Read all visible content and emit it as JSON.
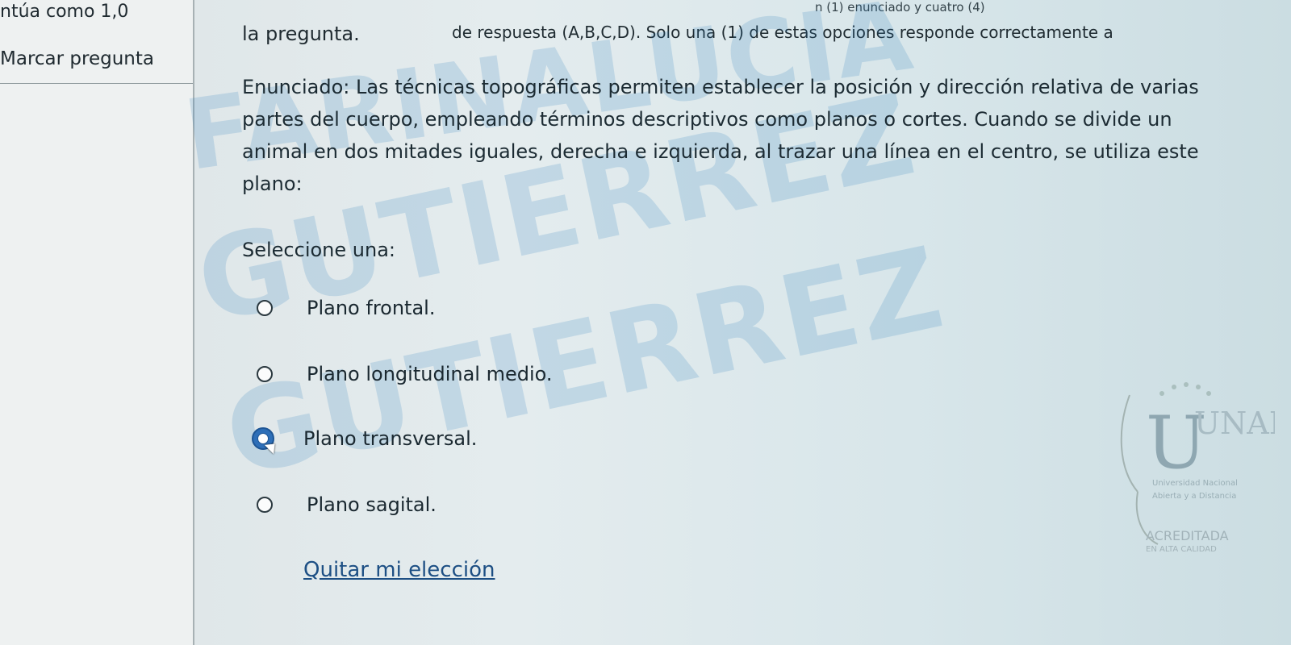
{
  "sidebar": {
    "grade_text": "ntúa como 1,0",
    "flag_label": "Marcar pregunta"
  },
  "header": {
    "top_small": "n (1) enunciado y cuatro (4)",
    "instructions_line": "de respuesta (A,B,C,D). Solo una (1) de estas opciones responde correctamente a",
    "instructions_end": "la pregunta."
  },
  "question": {
    "statement": "Enunciado: Las técnicas topográficas permiten establecer la posición y dirección relativa de varias partes del cuerpo, empleando términos descriptivos como planos o cortes. Cuando se divide un animal en dos mitades iguales, derecha e izquierda, al trazar una línea en el centro, se utiliza este plano:",
    "select_label": "Seleccione una:",
    "options": [
      {
        "label": "Plano frontal."
      },
      {
        "label": "Plano longitudinal medio."
      },
      {
        "label": "Plano transversal."
      },
      {
        "label": "Plano sagital."
      }
    ],
    "clear_label": "Quitar mi elección"
  },
  "watermark": {
    "line1": "FARINALUCIA",
    "line2": "GUTIERREZ",
    "line3": "GUTIERREZ"
  },
  "logo": {
    "letters": "UNAD",
    "caption1": "Universidad Nacional",
    "caption2": "Abierta y a Distancia",
    "accredited": "ACREDITADA",
    "quality": "EN ALTA CALIDAD"
  },
  "colors": {
    "accent": "#2e6fb8",
    "link": "#1d4f84",
    "watermark": "#2b7fbe"
  }
}
